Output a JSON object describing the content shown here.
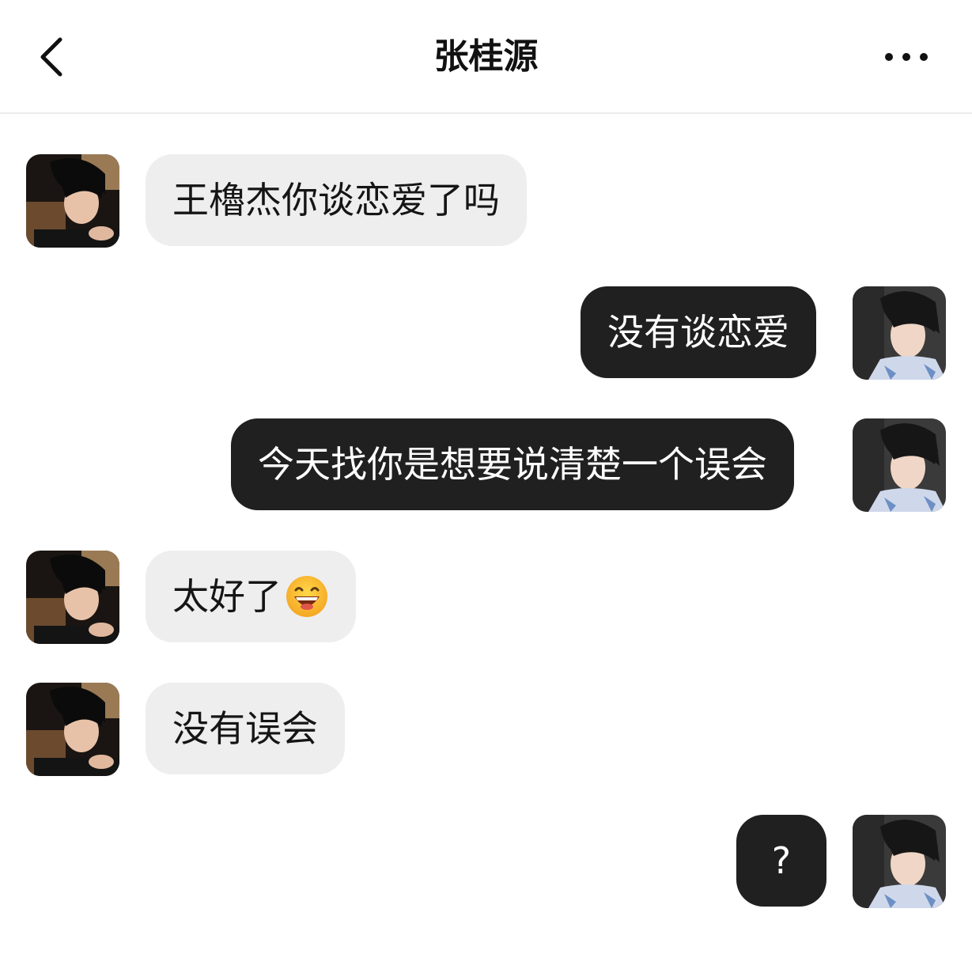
{
  "header": {
    "title": "张桂源",
    "back_icon": "chevron-left-icon",
    "more_icon": "more-horizontal-icon"
  },
  "messages": [
    {
      "side": "in",
      "text": "王櫓杰你谈恋爱了吗"
    },
    {
      "side": "out",
      "text": "没有谈恋爱"
    },
    {
      "side": "out",
      "text": "今天找你是想要说清楚一个误会"
    },
    {
      "side": "in",
      "text": "太好了",
      "emoji": "grinning-face-emoji"
    },
    {
      "side": "in",
      "text": "没有误会"
    },
    {
      "side": "out",
      "text": "?"
    }
  ],
  "colors": {
    "incoming_bubble": "#eeeeee",
    "outgoing_bubble": "#202020",
    "outgoing_text": "#ffffff",
    "background": "#ffffff"
  }
}
